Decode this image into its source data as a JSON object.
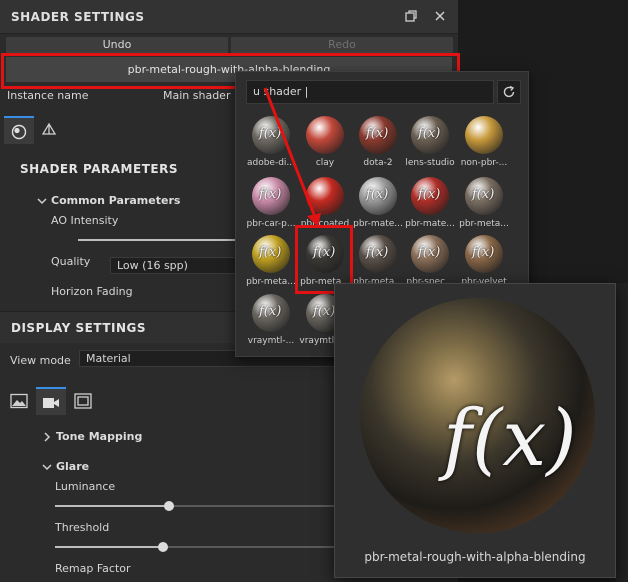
{
  "panel": {
    "title": "SHADER SETTINGS",
    "undo_label": "Undo",
    "redo_label": "Redo",
    "shader_name": "pbr-metal-rough-with-alpha-blending",
    "instance_name_label": "Instance name",
    "instance_name_value": "Main shader",
    "shader_parameters_heading": "SHADER PARAMETERS",
    "common_parameters_heading": "Common Parameters",
    "ao_intensity_label": "AO Intensity",
    "quality_label": "Quality",
    "quality_value": "Low (16 spp)",
    "horizon_fading_label": "Horizon Fading"
  },
  "display": {
    "heading": "DISPLAY SETTINGS",
    "view_mode_label": "View mode",
    "view_mode_value": "Material",
    "tone_mapping_label": "Tone Mapping",
    "glare_label": "Glare",
    "luminance_label": "Luminance",
    "luminance_level": 0.38,
    "threshold_label": "Threshold",
    "threshold_level": 0.36,
    "remap_factor_label": "Remap Factor"
  },
  "picker": {
    "search_value": "u shader |",
    "tiles": [
      {
        "name": "adobe-di...",
        "color": "#6e6a62",
        "fx": true
      },
      {
        "name": "clay",
        "color": "#c2483a",
        "fx": false
      },
      {
        "name": "dota-2",
        "color": "#8a3a2e",
        "fx": true
      },
      {
        "name": "lens-studio",
        "color": "#6b5f52",
        "fx": true
      },
      {
        "name": "non-pbr-...",
        "color": "#c89a3c",
        "fx": false
      },
      {
        "name": "pbr-car-p...",
        "color": "#c98aa8",
        "fx": true
      },
      {
        "name": "pbr-coated",
        "color": "#c42a20",
        "fx": false
      },
      {
        "name": "pbr-mate...",
        "color": "#9a9a9a",
        "fx": true
      },
      {
        "name": "pbr-mate...",
        "color": "#b02e28",
        "fx": true
      },
      {
        "name": "pbr-meta...",
        "color": "#7a6e62",
        "fx": true
      },
      {
        "name": "pbr-meta...",
        "color": "#c0a020",
        "fx": true
      },
      {
        "name": "pbr-meta...",
        "color": "#3a3834",
        "fx": true
      },
      {
        "name": "pbr-meta...",
        "color": "#5a5048",
        "fx": true
      },
      {
        "name": "pbr-spec...",
        "color": "#8a6e58",
        "fx": true
      },
      {
        "name": "pbr-velvet",
        "color": "#8a6848",
        "fx": true
      },
      {
        "name": "vraymtl-...",
        "color": "#6a6660",
        "fx": true
      },
      {
        "name": "vraymtl-s...",
        "color": "#6a6660",
        "fx": true
      }
    ]
  },
  "preview": {
    "caption": "pbr-metal-rough-with-alpha-blending",
    "fx_glyph": "f(x)"
  },
  "colors": {
    "highlight": "#e31212",
    "accent": "#3a8ee6"
  }
}
